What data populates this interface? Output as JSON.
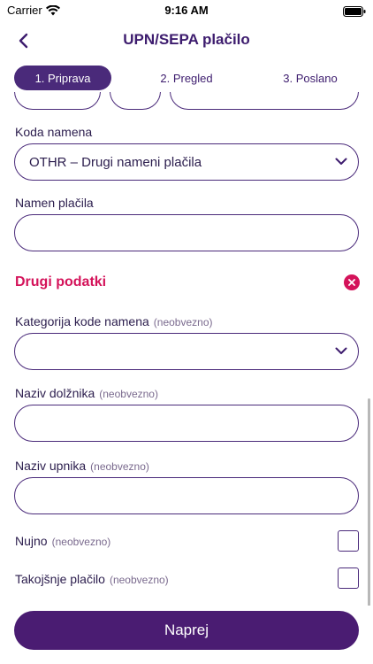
{
  "status": {
    "carrier": "Carrier",
    "time": "9:16 AM"
  },
  "nav": {
    "title": "UPN/SEPA plačilo",
    "back_icon": "chevron-left-icon"
  },
  "steps": [
    {
      "label": "1. Priprava",
      "active": true
    },
    {
      "label": "2. Pregled",
      "active": false
    },
    {
      "label": "3. Poslano",
      "active": false
    }
  ],
  "form": {
    "purpose_code": {
      "label": "Koda namena",
      "value": "OTHR – Drugi nameni plačila"
    },
    "payment_purpose": {
      "label": "Namen plačila",
      "value": ""
    },
    "other_data": {
      "title": "Drugi podatki"
    },
    "purpose_category": {
      "label": "Kategorija kode namena",
      "optional": "(neobvezno)",
      "value": ""
    },
    "debtor_name": {
      "label": "Naziv dolžnika",
      "optional": "(neobvezno)",
      "value": ""
    },
    "creditor_name": {
      "label": "Naziv upnika",
      "optional": "(neobvezno)",
      "value": ""
    },
    "urgent": {
      "label": "Nujno",
      "optional": "(neobvezno)",
      "checked": false
    },
    "instant": {
      "label": "Takojšnje plačilo",
      "optional": "(neobvezno)",
      "checked": false
    }
  },
  "actions": {
    "next_label": "Naprej"
  },
  "colors": {
    "primary": "#4a1c72",
    "accent": "#d4135a",
    "border": "#4a2a7a"
  }
}
